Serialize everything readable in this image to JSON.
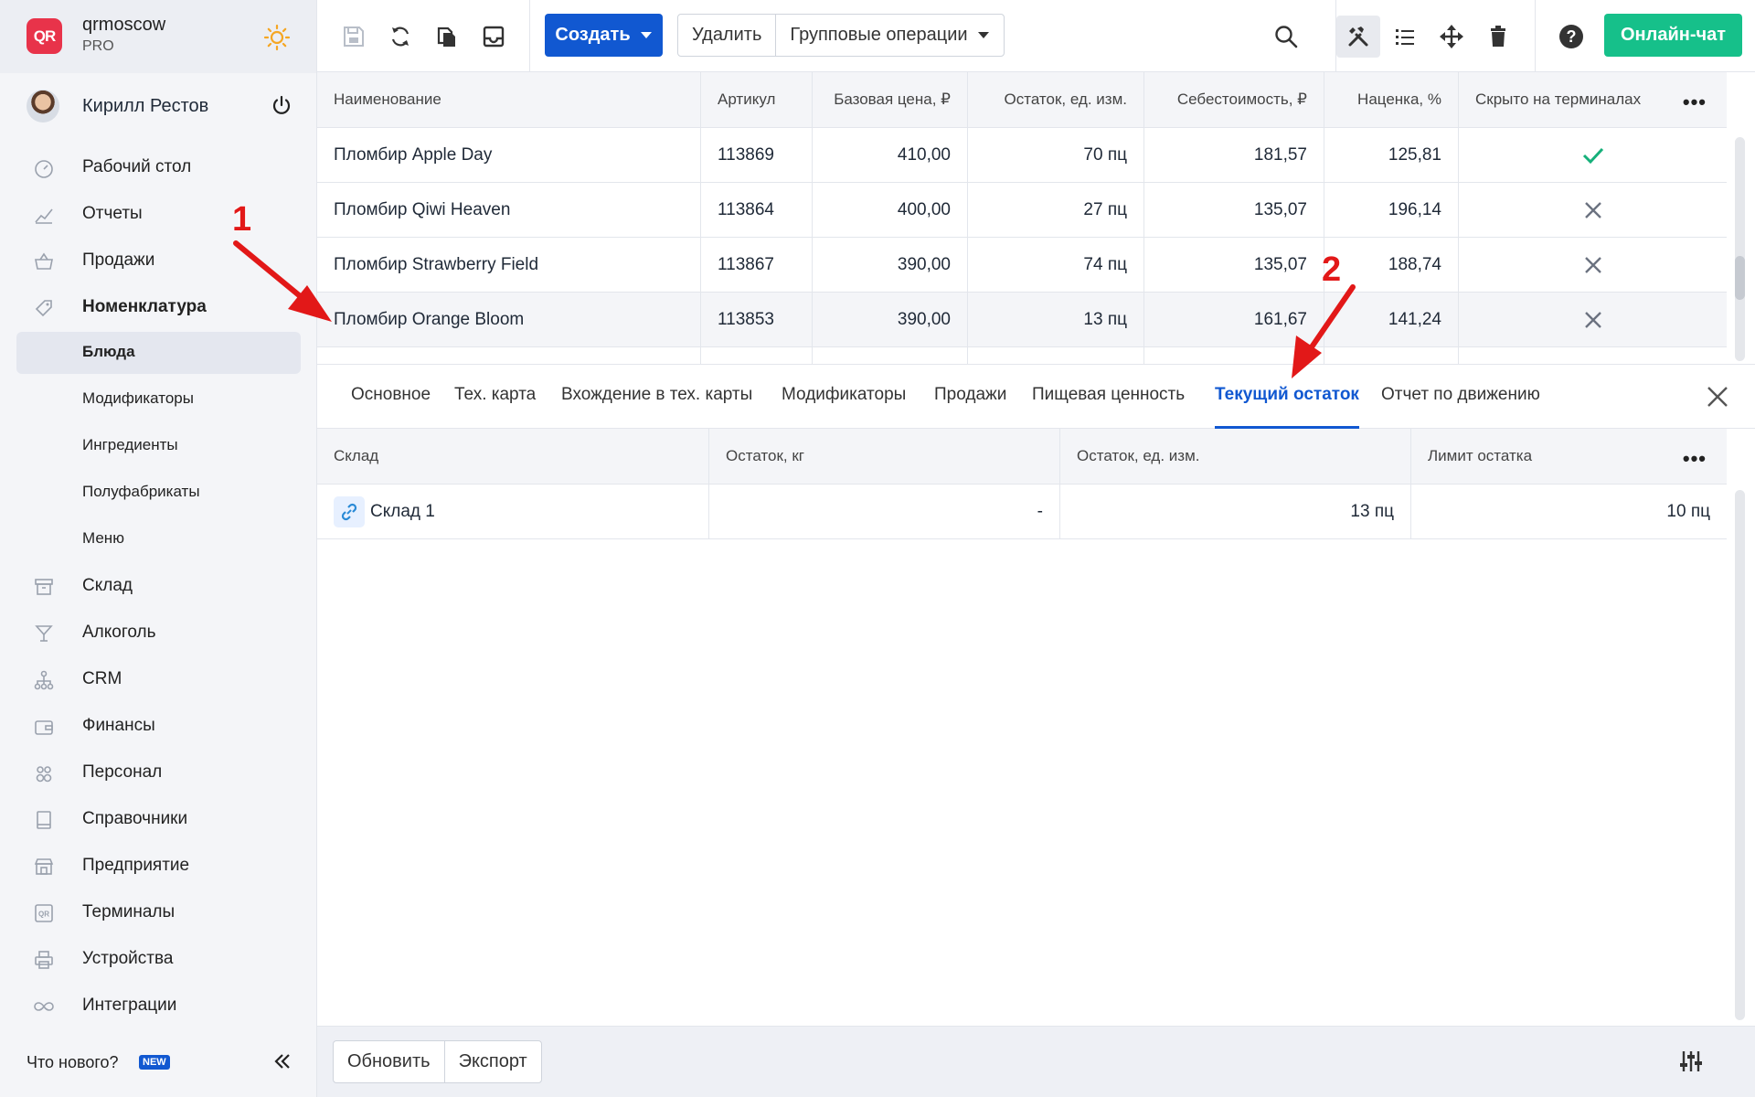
{
  "brand": {
    "name": "qrmoscow",
    "plan": "PRO",
    "logo_text": "QR"
  },
  "user": {
    "name": "Кирилл Рестов"
  },
  "nav": [
    {
      "label": "Рабочий стол",
      "icon": "dashboard-icon"
    },
    {
      "label": "Отчеты",
      "icon": "chart-icon"
    },
    {
      "label": "Продажи",
      "icon": "basket-icon"
    },
    {
      "label": "Номенклатура",
      "icon": "tag-icon",
      "active": true
    },
    {
      "label": "Блюда",
      "sub": true,
      "selected": true
    },
    {
      "label": "Модификаторы",
      "sub": true
    },
    {
      "label": "Ингредиенты",
      "sub": true
    },
    {
      "label": "Полуфабрикаты",
      "sub": true
    },
    {
      "label": "Меню",
      "sub": true
    },
    {
      "label": "Склад",
      "icon": "box-icon"
    },
    {
      "label": "Алкоголь",
      "icon": "glass-icon"
    },
    {
      "label": "CRM",
      "icon": "network-icon"
    },
    {
      "label": "Финансы",
      "icon": "wallet-icon"
    },
    {
      "label": "Персонал",
      "icon": "people-icon"
    },
    {
      "label": "Справочники",
      "icon": "book-icon"
    },
    {
      "label": "Предприятие",
      "icon": "store-icon"
    },
    {
      "label": "Терминалы",
      "icon": "terminal-icon"
    },
    {
      "label": "Устройства",
      "icon": "printer-icon"
    },
    {
      "label": "Интеграции",
      "icon": "infinity-icon"
    }
  ],
  "sidebar_footer": {
    "whats_new": "Что нового?",
    "badge": "NEW"
  },
  "toolbar": {
    "create": "Создать",
    "delete": "Удалить",
    "group_ops": "Групповые операции",
    "chat": "Онлайн-чат"
  },
  "items_table": {
    "columns": [
      "Наименование",
      "Артикул",
      "Базовая цена, ₽",
      "Остаток, ед. изм.",
      "Себестоимость, ₽",
      "Наценка, %",
      "Скрыто на терминалах"
    ],
    "rows": [
      {
        "name": "Пломбир Apple Day",
        "sku": "113869",
        "price": "410,00",
        "stock": "70 пц",
        "cost": "181,57",
        "markup": "125,81",
        "hidden": true
      },
      {
        "name": "Пломбир Qiwi Heaven",
        "sku": "113864",
        "price": "400,00",
        "stock": "27 пц",
        "cost": "135,07",
        "markup": "196,14",
        "hidden": false
      },
      {
        "name": "Пломбир Strawberry Field",
        "sku": "113867",
        "price": "390,00",
        "stock": "74 пц",
        "cost": "135,07",
        "markup": "188,74",
        "hidden": false
      },
      {
        "name": "Пломбир Orange Bloom",
        "sku": "113853",
        "price": "390,00",
        "stock": "13 пц",
        "cost": "161,67",
        "markup": "141,24",
        "hidden": false
      }
    ]
  },
  "tabs": [
    "Основное",
    "Тех. карта",
    "Вхождение в тех. карты",
    "Модификаторы",
    "Продажи",
    "Пищевая ценность",
    "Текущий остаток",
    "Отчет по движению"
  ],
  "active_tab": "Текущий остаток",
  "stock_table": {
    "columns": [
      "Склад",
      "Остаток, кг",
      "Остаток, ед. изм.",
      "Лимит остатка"
    ],
    "rows": [
      {
        "warehouse": "Склад 1",
        "kg": "-",
        "units": "13 пц",
        "limit": "10 пц"
      }
    ]
  },
  "footer": {
    "refresh": "Обновить",
    "export": "Экспорт"
  },
  "annotations": {
    "one": "1",
    "two": "2"
  },
  "colors": {
    "accent": "#1158d1",
    "chat": "#16c08a",
    "annotation": "#e21818",
    "check": "#16b07a"
  }
}
